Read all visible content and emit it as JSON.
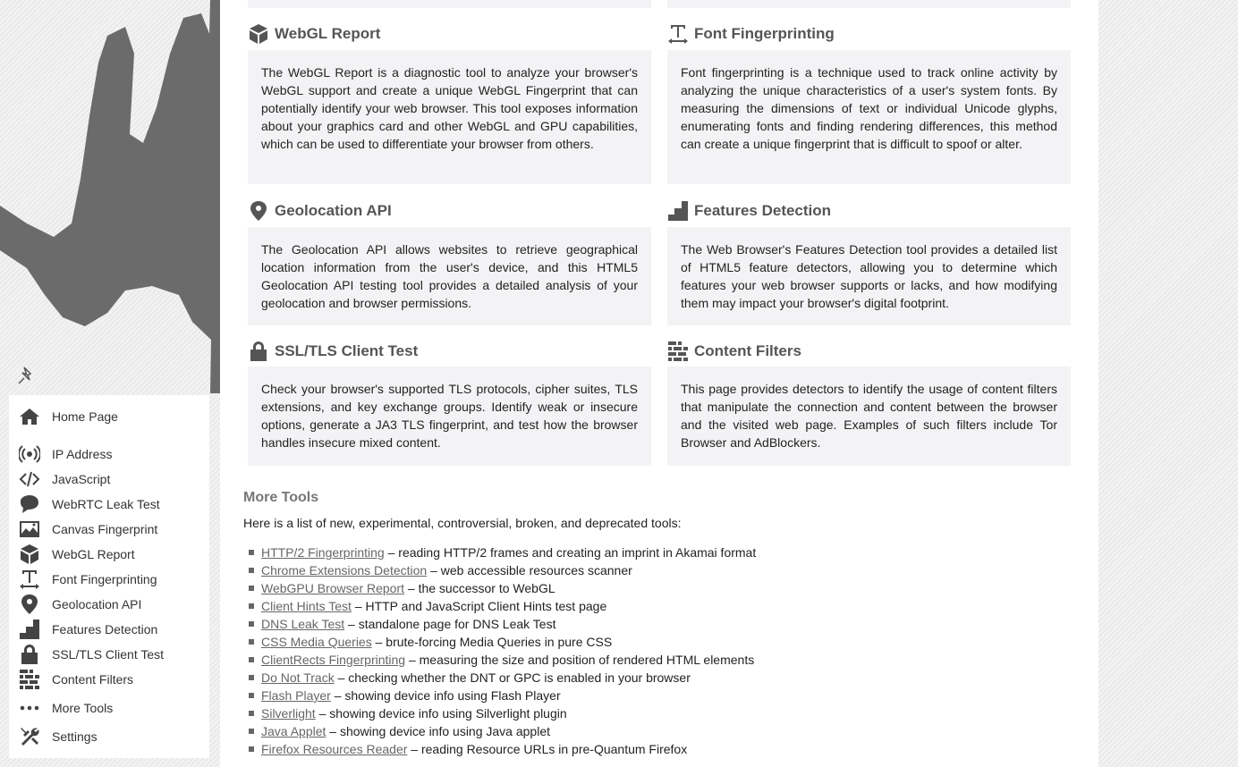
{
  "sidebar": {
    "items": [
      {
        "label": "Home Page",
        "icon": "home"
      },
      {
        "label": "IP Address",
        "icon": "broadcast"
      },
      {
        "label": "JavaScript",
        "icon": "code"
      },
      {
        "label": "WebRTC Leak Test",
        "icon": "chat"
      },
      {
        "label": "Canvas Fingerprint",
        "icon": "image"
      },
      {
        "label": "WebGL Report",
        "icon": "cube"
      },
      {
        "label": "Font Fingerprinting",
        "icon": "text-width"
      },
      {
        "label": "Geolocation API",
        "icon": "map-pin"
      },
      {
        "label": "Features Detection",
        "icon": "stairs"
      },
      {
        "label": "SSL/TLS Client Test",
        "icon": "lock"
      },
      {
        "label": "Content Filters",
        "icon": "brick-wall"
      },
      {
        "label": "More Tools",
        "icon": "ellipsis"
      },
      {
        "label": "Settings",
        "icon": "tools"
      }
    ]
  },
  "cards": [
    {
      "title": "WebGL Report",
      "icon": "cube",
      "text": "The WebGL Report is a diagnostic tool to analyze your browser's WebGL support and create a unique WebGL Fingerprint that can potentially identify your web browser. This tool exposes information about your graphics card and other WebGL and GPU capabilities, which can be used to differentiate your browser from others."
    },
    {
      "title": "Font Fingerprinting",
      "icon": "text-width",
      "text": "Font fingerprinting is a technique used to track online activity by analyzing the unique characteristics of a user's system fonts. By measuring the dimensions of text or individual Unicode glyphs, enumerating fonts and finding rendering differences, this method can create a unique fingerprint that is difficult to spoof or alter."
    },
    {
      "title": "Geolocation API",
      "icon": "map-pin",
      "text": "The Geolocation API allows websites to retrieve geographical location information from the user's device, and this HTML5 Geolocation API testing tool provides a detailed analysis of your geolocation and browser permissions."
    },
    {
      "title": "Features Detection",
      "icon": "stairs",
      "text": "The Web Browser's Features Detection tool provides a detailed list of HTML5 feature detectors, allowing you to determine which features your web browser supports or lacks, and how modifying them may impact your browser's digital footprint."
    },
    {
      "title": "SSL/TLS Client Test",
      "icon": "lock",
      "text": "Check your browser's supported TLS protocols, cipher suites, TLS extensions, and key exchange groups. Identify weak or insecure options, generate a JA3 TLS fingerprint, and test how the browser handles insecure mixed content."
    },
    {
      "title": "Content Filters",
      "icon": "brick-wall",
      "text": "This page provides detectors to identify the usage of content filters that manipulate the connection and content between the browser and the visited web page. Examples of such filters include Tor Browser and AdBlockers."
    }
  ],
  "more_tools": {
    "title": "More Tools",
    "intro": "Here is a list of new, experimental, controversial, broken, and deprecated tools:",
    "items": [
      {
        "link": "HTTP/2 Fingerprinting",
        "desc": " – reading HTTP/2 frames and creating an imprint in Akamai format"
      },
      {
        "link": "Chrome Extensions Detection",
        "desc": " – web accessible resources scanner"
      },
      {
        "link": "WebGPU Browser Report",
        "desc": " – the successor to WebGL"
      },
      {
        "link": "Client Hints Test",
        "desc": " – HTTP and JavaScript Client Hints test page"
      },
      {
        "link": "DNS Leak Test",
        "desc": " – standalone page for DNS Leak Test"
      },
      {
        "link": "CSS Media Queries",
        "desc": " – brute-forcing Media Queries in pure CSS"
      },
      {
        "link": "ClientRects Fingerprinting",
        "desc": " – measuring the size and position of rendered HTML elements"
      },
      {
        "link": "Do Not Track",
        "desc": " – checking whether the DNT or GPC is enabled in your browser"
      },
      {
        "link": "Flash Player",
        "desc": " – showing device info using Flash Player"
      },
      {
        "link": "Silverlight",
        "desc": " – showing device info using Silverlight plugin"
      },
      {
        "link": "Java Applet",
        "desc": " – showing device info using Java applet"
      },
      {
        "link": "Firefox Resources Reader",
        "desc": " – reading Resource URLs in pre-Quantum Firefox"
      }
    ]
  },
  "colors": {
    "card_bg": "#f3f3f5",
    "heading": "#555555",
    "link": "#666666",
    "silhouette": "#6b6b6b"
  }
}
